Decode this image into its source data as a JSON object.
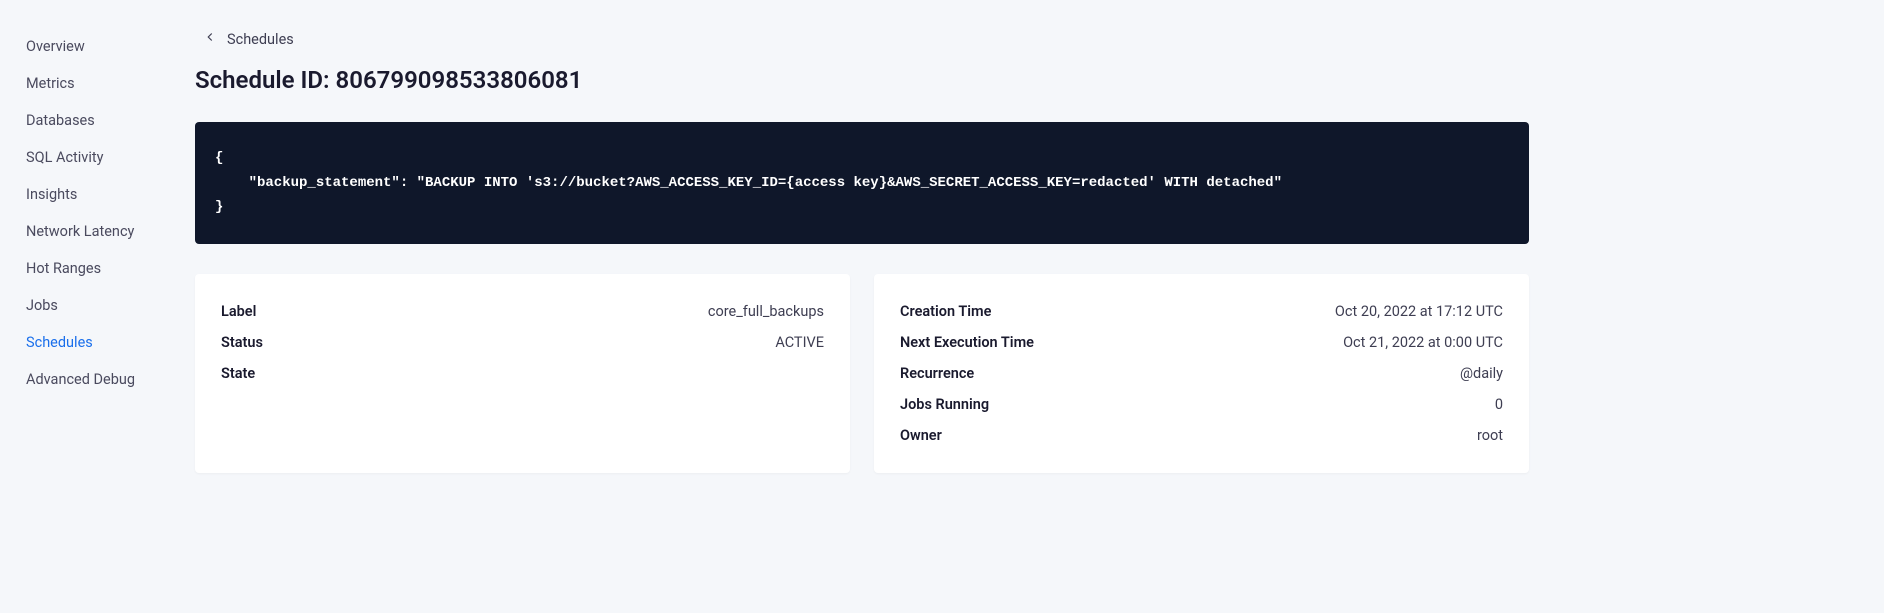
{
  "sidebar": {
    "items": [
      {
        "label": "Overview",
        "active": false
      },
      {
        "label": "Metrics",
        "active": false
      },
      {
        "label": "Databases",
        "active": false
      },
      {
        "label": "SQL Activity",
        "active": false
      },
      {
        "label": "Insights",
        "active": false
      },
      {
        "label": "Network Latency",
        "active": false
      },
      {
        "label": "Hot Ranges",
        "active": false
      },
      {
        "label": "Jobs",
        "active": false
      },
      {
        "label": "Schedules",
        "active": true
      },
      {
        "label": "Advanced Debug",
        "active": false
      }
    ]
  },
  "breadcrumb": {
    "label": "Schedules"
  },
  "page": {
    "title": "Schedule ID: 806799098533806081"
  },
  "code": {
    "content": "{\n    \"backup_statement\": \"BACKUP INTO 's3://bucket?AWS_ACCESS_KEY_ID={access key}&AWS_SECRET_ACCESS_KEY=redacted' WITH detached\"\n}"
  },
  "card_left": {
    "rows": [
      {
        "label": "Label",
        "value": "core_full_backups"
      },
      {
        "label": "Status",
        "value": "ACTIVE"
      },
      {
        "label": "State",
        "value": ""
      }
    ]
  },
  "card_right": {
    "rows": [
      {
        "label": "Creation Time",
        "value": "Oct 20, 2022 at 17:12 UTC"
      },
      {
        "label": "Next Execution Time",
        "value": "Oct 21, 2022 at 0:00 UTC"
      },
      {
        "label": "Recurrence",
        "value": "@daily"
      },
      {
        "label": "Jobs Running",
        "value": "0"
      },
      {
        "label": "Owner",
        "value": "root"
      }
    ]
  }
}
